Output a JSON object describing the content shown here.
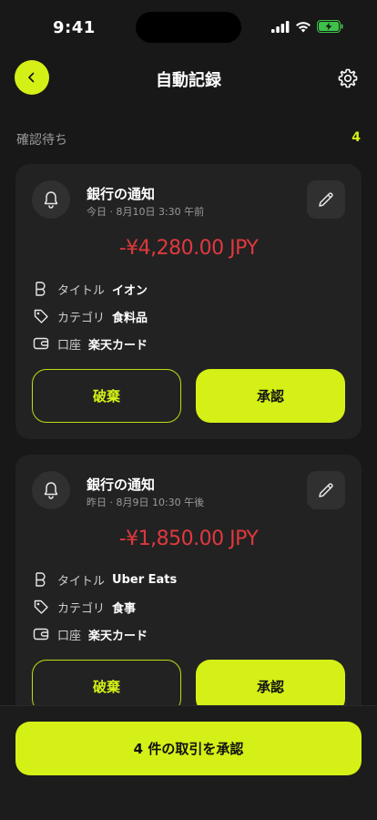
{
  "status_bar": {
    "time": "9:41"
  },
  "header": {
    "title": "自動記録",
    "back_icon": "chevron-left-icon",
    "settings_icon": "gear-icon"
  },
  "section": {
    "label": "確認待ち",
    "count": "4"
  },
  "colors": {
    "accent": "#d4f016",
    "amount_negative": "#e0383e",
    "background": "#181818",
    "card": "#222222"
  },
  "cards": [
    {
      "title": "銀行の通知",
      "subtitle": "今日 · 8月10日 3:30 午前",
      "amount": "-¥4,280.00 JPY",
      "details": [
        {
          "label": "タイトル",
          "value": "イオン",
          "icon": "merchant-icon"
        },
        {
          "label": "カテゴリ",
          "value": "食料品",
          "icon": "tag-icon"
        },
        {
          "label": "口座",
          "value": "楽天カード",
          "icon": "wallet-icon"
        }
      ],
      "discard_label": "破棄",
      "approve_label": "承認"
    },
    {
      "title": "銀行の通知",
      "subtitle": "昨日 · 8月9日 10:30 午後",
      "amount": "-¥1,850.00 JPY",
      "details": [
        {
          "label": "タイトル",
          "value": "Uber Eats",
          "icon": "merchant-icon"
        },
        {
          "label": "カテゴリ",
          "value": "食事",
          "icon": "tag-icon"
        },
        {
          "label": "口座",
          "value": "楽天カード",
          "icon": "wallet-icon"
        }
      ],
      "discard_label": "破棄",
      "approve_label": "承認"
    }
  ],
  "footer": {
    "approve_all_label": "4 件の取引を承認"
  }
}
